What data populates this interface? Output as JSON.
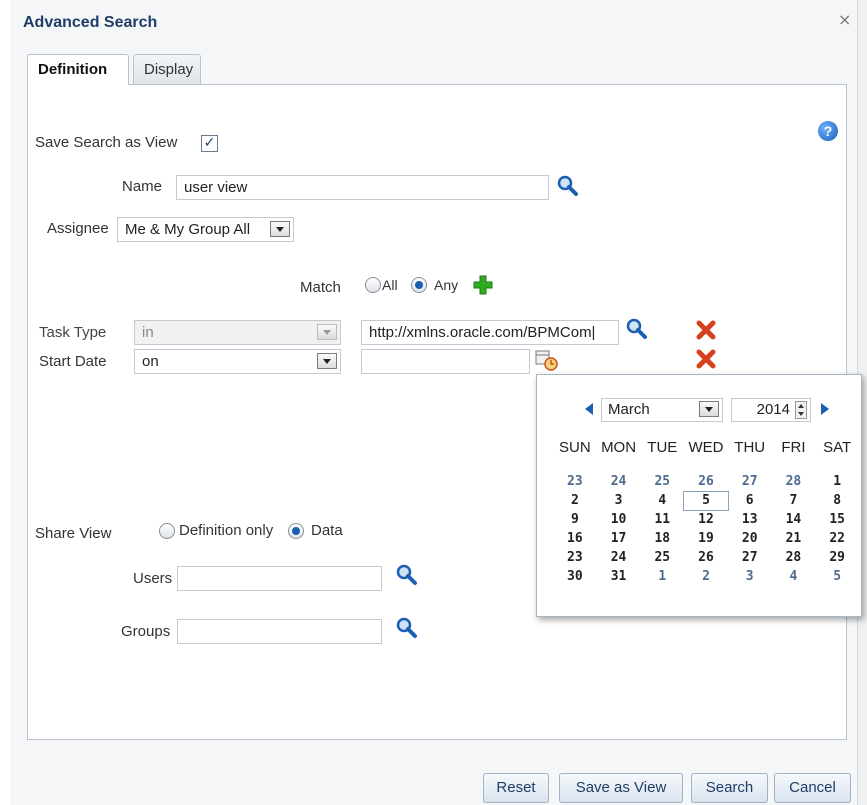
{
  "dialog": {
    "title": "Advanced Search",
    "close_glyph": "×"
  },
  "tabs": [
    {
      "label": "Definition",
      "active": true
    },
    {
      "label": "Display",
      "active": false
    }
  ],
  "help": {
    "glyph": "?",
    "icon": "help-icon"
  },
  "save_search": {
    "label": "Save Search as View",
    "checked": true,
    "check_glyph": "✓"
  },
  "name": {
    "label": "Name",
    "value": "user view"
  },
  "assignee": {
    "label": "Assignee",
    "value": "Me & My Group All"
  },
  "match": {
    "label": "Match",
    "options": [
      "All",
      "Any"
    ],
    "selected": "Any"
  },
  "criteria": [
    {
      "label": "Task Type",
      "operator": "in",
      "value": "http://xmlns.oracle.com/BPMCom|",
      "disabled": true
    },
    {
      "label": "Start Date",
      "operator": "on",
      "value": "",
      "disabled": false
    }
  ],
  "share_view": {
    "label": "Share View",
    "options": [
      "Definition only",
      "Data"
    ],
    "selected": "Data"
  },
  "users": {
    "label": "Users",
    "value": ""
  },
  "groups": {
    "label": "Groups",
    "value": ""
  },
  "calendar": {
    "month": "March",
    "year": "2014",
    "weekdays": [
      "SUN",
      "MON",
      "TUE",
      "WED",
      "THU",
      "FRI",
      "SAT"
    ],
    "selected_day": "5",
    "weeks": [
      [
        {
          "d": "23",
          "o": true
        },
        {
          "d": "24",
          "o": true
        },
        {
          "d": "25",
          "o": true
        },
        {
          "d": "26",
          "o": true
        },
        {
          "d": "27",
          "o": true
        },
        {
          "d": "28",
          "o": true
        },
        {
          "d": "1",
          "o": false
        }
      ],
      [
        {
          "d": "2",
          "o": false
        },
        {
          "d": "3",
          "o": false
        },
        {
          "d": "4",
          "o": false
        },
        {
          "d": "5",
          "o": false
        },
        {
          "d": "6",
          "o": false
        },
        {
          "d": "7",
          "o": false
        },
        {
          "d": "8",
          "o": false
        }
      ],
      [
        {
          "d": "9",
          "o": false
        },
        {
          "d": "10",
          "o": false
        },
        {
          "d": "11",
          "o": false
        },
        {
          "d": "12",
          "o": false
        },
        {
          "d": "13",
          "o": false
        },
        {
          "d": "14",
          "o": false
        },
        {
          "d": "15",
          "o": false
        }
      ],
      [
        {
          "d": "16",
          "o": false
        },
        {
          "d": "17",
          "o": false
        },
        {
          "d": "18",
          "o": false
        },
        {
          "d": "19",
          "o": false
        },
        {
          "d": "20",
          "o": false
        },
        {
          "d": "21",
          "o": false
        },
        {
          "d": "22",
          "o": false
        }
      ],
      [
        {
          "d": "23",
          "o": false
        },
        {
          "d": "24",
          "o": false
        },
        {
          "d": "25",
          "o": false
        },
        {
          "d": "26",
          "o": false
        },
        {
          "d": "27",
          "o": false
        },
        {
          "d": "28",
          "o": false
        },
        {
          "d": "29",
          "o": false
        }
      ],
      [
        {
          "d": "30",
          "o": false
        },
        {
          "d": "31",
          "o": false
        },
        {
          "d": "1",
          "o": true
        },
        {
          "d": "2",
          "o": true
        },
        {
          "d": "3",
          "o": true
        },
        {
          "d": "4",
          "o": true
        },
        {
          "d": "5",
          "o": true
        }
      ]
    ]
  },
  "buttons": {
    "reset": "Reset",
    "save_as_view": "Save as View",
    "search": "Search",
    "cancel": "Cancel"
  },
  "colors": {
    "title": "#1f3d66",
    "accent": "#1b5fb3",
    "add": "#2eaa1f",
    "delete": "#d6401a"
  }
}
